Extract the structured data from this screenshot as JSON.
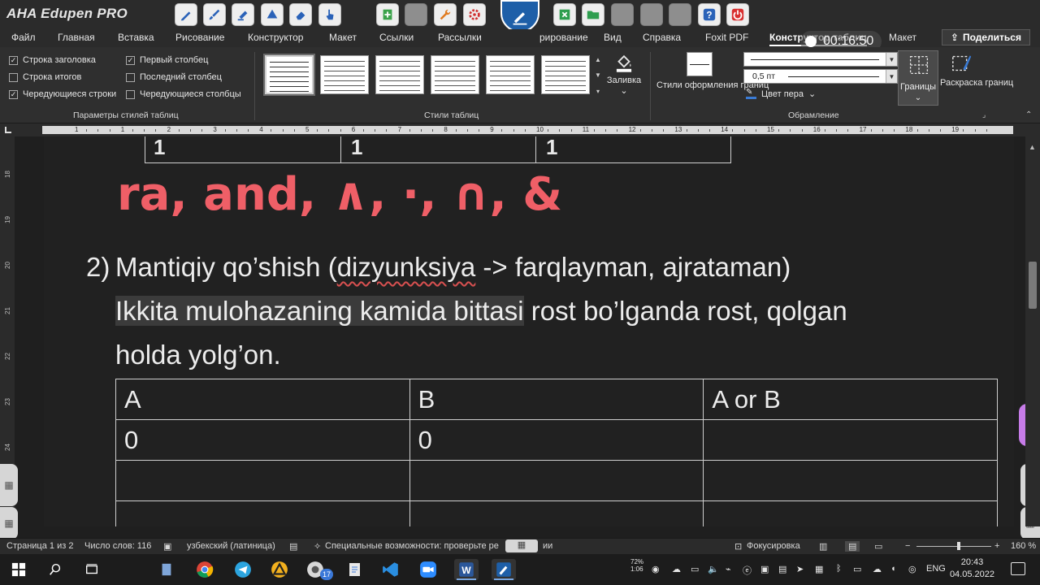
{
  "edupen": {
    "logo": "AHA Edupen PRO",
    "tools": [
      {
        "name": "pen-tool",
        "icon": "pen-icon"
      },
      {
        "name": "brush-tool",
        "icon": "brush-icon"
      },
      {
        "name": "highlighter-tool",
        "icon": "highlighter-icon"
      },
      {
        "name": "shapes-tool",
        "icon": "shapes-icon"
      },
      {
        "name": "eraser-tool",
        "icon": "eraser-icon"
      },
      {
        "name": "pointer-tool",
        "icon": "hand-pointer-icon"
      },
      {
        "name": "add-page-tool",
        "icon": "plus-icon"
      },
      {
        "name": "blank-tool",
        "icon": "blank-icon"
      },
      {
        "name": "tools-tool",
        "icon": "wrench-icon"
      },
      {
        "name": "settings-tool",
        "icon": "gear-icon"
      },
      {
        "name": "excel-tool",
        "icon": "excel-icon"
      },
      {
        "name": "folder-tool",
        "icon": "folder-icon"
      },
      {
        "name": "blank-tool-2",
        "icon": "blank-icon"
      },
      {
        "name": "blank-tool-3",
        "icon": "blank-icon"
      },
      {
        "name": "blank-tool-4",
        "icon": "blank-icon"
      },
      {
        "name": "help-tool",
        "icon": "question-icon"
      },
      {
        "name": "power-tool",
        "icon": "power-icon"
      }
    ]
  },
  "ribbon_tabs": {
    "file": "Файл",
    "home": "Главная",
    "insert": "Вставка",
    "draw": "Рисование",
    "design": "Конструктор",
    "layout": "Макет",
    "references": "Ссылки",
    "mailings": "Рассылки",
    "review": "рирование",
    "view": "Вид",
    "help": "Справка",
    "foxit": "Foxit PDF",
    "table_design": "Конструктор таблиц",
    "table_layout": "Макет",
    "share": "Поделиться"
  },
  "timer": "00:16:50",
  "table_style_options": {
    "header_row": {
      "label": "Строка заголовка",
      "checked": true
    },
    "total_row": {
      "label": "Строка итогов",
      "checked": false
    },
    "banded_rows": {
      "label": "Чередующиеся строки",
      "checked": true
    },
    "first_column": {
      "label": "Первый столбец",
      "checked": true
    },
    "last_column": {
      "label": "Последний столбец",
      "checked": false
    },
    "banded_columns": {
      "label": "Чередующиеся столбцы",
      "checked": false
    },
    "group_label": "Параметры стилей таблиц"
  },
  "table_styles": {
    "group_label": "Стили таблиц",
    "shading_label": "Заливка"
  },
  "borders": {
    "border_styles_label": "Стили оформления границ",
    "pen_weight": "0,5 пт",
    "pen_color_label": "Цвет пера",
    "borders_label": "Границы",
    "border_painter_label": "Раскраска границ",
    "group_label": "Обрамление"
  },
  "ruler": {
    "h_numbers": [
      "1",
      "1",
      "2",
      "3",
      "4",
      "5",
      "6",
      "7",
      "8",
      "9",
      "10",
      "11",
      "12",
      "13",
      "14",
      "15",
      "16",
      "17",
      "18",
      "19"
    ],
    "v_numbers": [
      "18",
      "19",
      "20",
      "21",
      "22",
      "23",
      "24"
    ]
  },
  "document": {
    "top_table_marks": [
      "1",
      "1",
      "1"
    ],
    "handwriting": "ra, and, ∧, ·, ∩, &",
    "para_number": "2)",
    "para_line1_a": "Mantiqiy qo’shish (",
    "para_line1_squig": "dizyunksiya",
    "para_line1_b": " -> farqlayman, ajrataman)",
    "para_line2_hl": "Ikkita mulohazaning kamida bittasi",
    "para_line2_rest": " rost bo’lganda rost, qolgan",
    "para_line3": "holda yolg’on.",
    "truth_table": [
      [
        "A",
        "B",
        "A or B"
      ],
      [
        "0",
        "0",
        ""
      ],
      [
        "",
        "",
        ""
      ],
      [
        "",
        "",
        ""
      ]
    ]
  },
  "status_bar": {
    "page": "Страница 1 из 2",
    "words": "Число слов: 116",
    "language": "узбекский (латиница)",
    "accessibility": "Специальные возможности: проверьте ре",
    "accessibility_tail": "ии",
    "focus": "Фокусировка",
    "zoom": "160 %"
  },
  "taskbar": {
    "apps": [
      "windows",
      "search",
      "task-view",
      "file",
      "chrome",
      "telegram",
      "autocad",
      "edupen-cam",
      "telegram-badge",
      "notepad",
      "vscode",
      "zoom",
      "word",
      "edupen"
    ],
    "badge": "17",
    "tray_cpu": "72%\n1:06",
    "lang": "ENG",
    "time": "20:43",
    "date": "04.05.2022"
  }
}
